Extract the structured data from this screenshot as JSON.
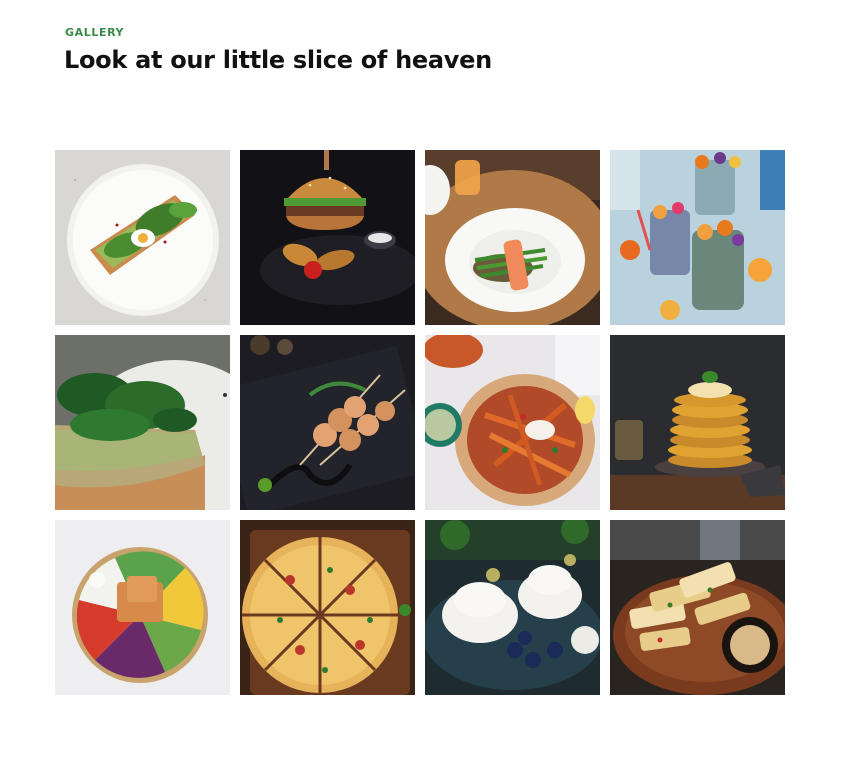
{
  "section": {
    "eyebrow": "GALLERY",
    "title": "Look at our little slice of heaven"
  },
  "gallery": {
    "items": [
      {
        "name": "avocado-toast-plate"
      },
      {
        "name": "burger-with-fries"
      },
      {
        "name": "salmon-green-beans"
      },
      {
        "name": "fruit-parfait-cups"
      },
      {
        "name": "spinach-avocado-toast"
      },
      {
        "name": "shrimp-skewers"
      },
      {
        "name": "sweet-potato-fries"
      },
      {
        "name": "pancake-stack"
      },
      {
        "name": "poke-bowl"
      },
      {
        "name": "sliced-pizza"
      },
      {
        "name": "meringue-blueberries"
      },
      {
        "name": "grilled-halloumi"
      }
    ]
  }
}
